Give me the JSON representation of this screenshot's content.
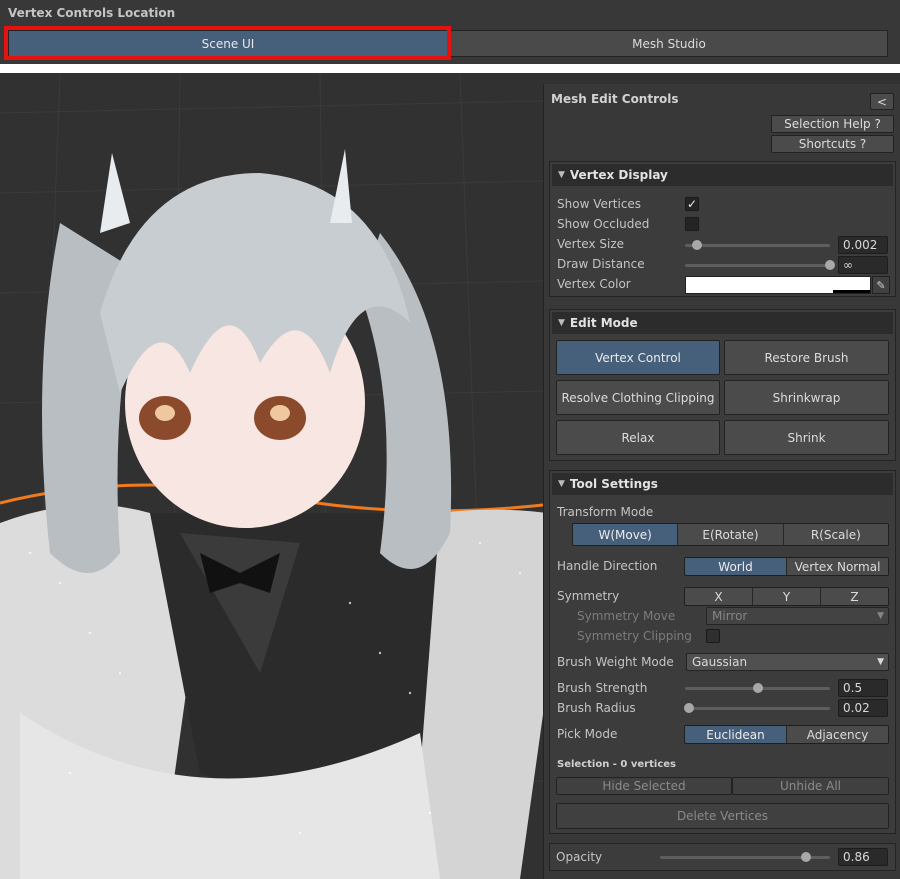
{
  "topbar": {
    "title": "Vertex Controls Location",
    "scene_ui": "Scene UI",
    "mesh_studio": "Mesh Studio"
  },
  "panel": {
    "title": "Mesh Edit Controls",
    "collapse": "<",
    "selection_help": "Selection Help ?",
    "shortcuts": "Shortcuts ?",
    "vertex_display": {
      "header": "Vertex Display",
      "show_vertices": "Show Vertices",
      "show_vertices_checked": true,
      "show_occluded": "Show Occluded",
      "show_occluded_checked": false,
      "vertex_size": "Vertex Size",
      "vertex_size_value": "0.002",
      "vertex_size_level": 0.08,
      "draw_distance": "Draw Distance",
      "draw_distance_value": "∞",
      "draw_distance_level": 1.0,
      "vertex_color": "Vertex Color",
      "vertex_color_hex": "#FFFFFF"
    },
    "edit_mode": {
      "header": "Edit Mode",
      "vertex_control": "Vertex Control",
      "restore_brush": "Restore Brush",
      "resolve_clipping": "Resolve Clothing Clipping",
      "shrinkwrap": "Shrinkwrap",
      "relax": "Relax",
      "shrink": "Shrink"
    },
    "tool_settings": {
      "header": "Tool Settings",
      "transform_mode": "Transform Mode",
      "move": "W(Move)",
      "rotate": "E(Rotate)",
      "scale": "R(Scale)",
      "handle_direction": "Handle Direction",
      "world": "World",
      "vertex_normal": "Vertex Normal",
      "symmetry": "Symmetry",
      "x": "X",
      "y": "Y",
      "z": "Z",
      "symmetry_move": "Symmetry Move",
      "symmetry_move_value": "Mirror",
      "symmetry_clipping": "Symmetry Clipping",
      "brush_weight_mode": "Brush Weight Mode",
      "brush_weight_value": "Gaussian",
      "brush_strength": "Brush Strength",
      "brush_strength_value": "0.5",
      "brush_strength_level": 0.5,
      "brush_radius": "Brush Radius",
      "brush_radius_value": "0.02",
      "brush_radius_level": 0.03,
      "pick_mode": "Pick Mode",
      "euclidean": "Euclidean",
      "adjacency": "Adjacency",
      "selection_info": "Selection - 0 vertices",
      "hide_selected": "Hide Selected",
      "unhide_all": "Unhide All",
      "delete_vertices": "Delete Vertices"
    },
    "opacity": "Opacity",
    "opacity_value": "0.86",
    "opacity_level": 0.86
  },
  "colors": {
    "accent": "#46607C",
    "highlight": "#E51212",
    "outline": "#F07A1E"
  }
}
